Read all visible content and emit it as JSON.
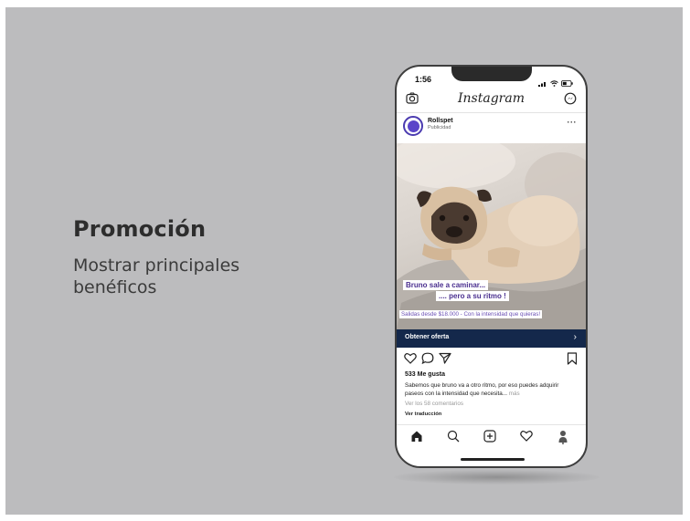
{
  "slide": {
    "title": "Promoción",
    "subtitle": "Mostrar principales benéficos"
  },
  "phone": {
    "status_time": "1:56",
    "app_name": "Instagram",
    "post": {
      "account_name": "Rollspet",
      "account_subtitle": "Publicidad",
      "more_label": "···",
      "image_caption_line1": "Bruno sale a caminar...",
      "image_caption_line2": ".... pero a su ritmo !",
      "image_caption_line3": "Salidas desde $18.000 - Con la intensidad que quieras!",
      "cta_label": "Obtener oferta",
      "cta_arrow": "›",
      "likes": "533 Me gusta",
      "description": "Sabemos que bruno va a otro ritmo, por eso puedes adquirir paseos con la intensidad que necesita...",
      "description_more": "más",
      "comments_link": "Ver los 58 comentarios",
      "translate_link": "Ver traducción"
    }
  },
  "colors": {
    "slide_bg": "#bcbcbe",
    "cta_bg": "#14284b",
    "caption_text": "#4a2f8f"
  },
  "icons": [
    "camera-icon",
    "messenger-icon",
    "heart-icon",
    "comment-icon",
    "share-icon",
    "bookmark-icon",
    "home-icon",
    "search-icon",
    "add-icon",
    "activity-icon",
    "profile-icon"
  ]
}
